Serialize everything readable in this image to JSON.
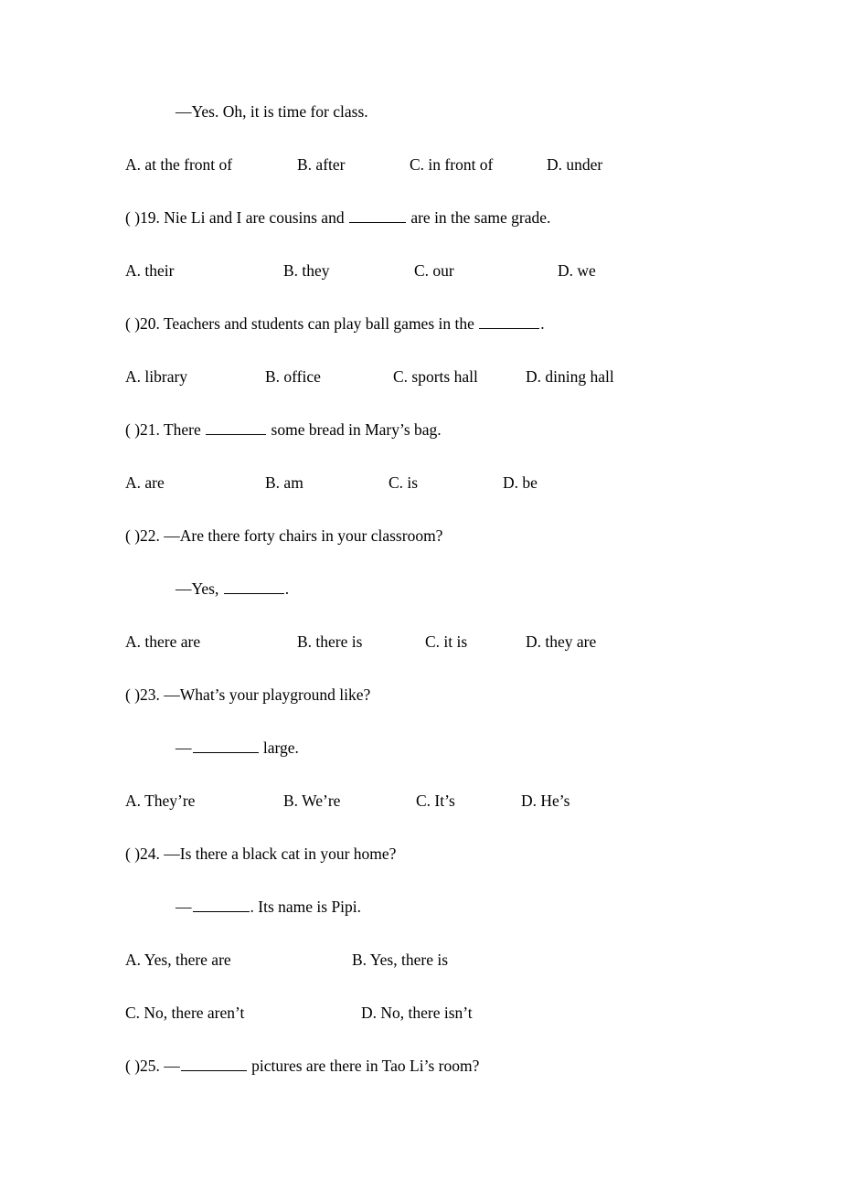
{
  "document": {
    "type": "english-exam-worksheet",
    "background_color": "#ffffff",
    "text_color": "#000000"
  },
  "blocks": [
    {
      "id": "q18-answer-line",
      "kind": "dialogue",
      "indent": true,
      "text": "—Yes. Oh, it is time for class."
    },
    {
      "id": "q18-options",
      "kind": "options",
      "columns": [
        137,
        325,
        448,
        598
      ],
      "options": [
        "A. at the front of",
        "B. after",
        "C. in front of",
        "D. under"
      ]
    },
    {
      "id": "q19-stem",
      "kind": "stem",
      "marker": "(  )19.",
      "before": " Nie Li and I are cousins and ",
      "blank": "w62",
      "after": " are in the same grade."
    },
    {
      "id": "q19-options",
      "kind": "options",
      "columns": [
        137,
        310,
        453,
        610
      ],
      "options": [
        "A. their",
        "B. they",
        "C. our",
        "D. we"
      ]
    },
    {
      "id": "q20-stem",
      "kind": "stem",
      "marker": "(  )20.",
      "before": " Teachers and students can play ball games in the ",
      "blank": "w66",
      "after": "."
    },
    {
      "id": "q20-options",
      "kind": "options",
      "columns": [
        137,
        290,
        430,
        575
      ],
      "options": [
        "A. library",
        "B. office",
        "C. sports hall",
        "D. dining hall"
      ]
    },
    {
      "id": "q21-stem",
      "kind": "stem",
      "marker": "(  )21.",
      "before": " There ",
      "blank": "w66",
      "after": " some bread in Mary’s bag."
    },
    {
      "id": "q21-options",
      "kind": "options",
      "columns": [
        137,
        290,
        425,
        550
      ],
      "options": [
        "A. are",
        "B. am",
        "C. is",
        "D. be"
      ]
    },
    {
      "id": "q22-stem",
      "kind": "plain-stem",
      "text": "(  )22. —Are there forty chairs in your classroom?"
    },
    {
      "id": "q22-answer-line",
      "kind": "dialogue-blank",
      "indent": true,
      "before": "—Yes, ",
      "blank": "w66",
      "after": "."
    },
    {
      "id": "q22-options",
      "kind": "options",
      "columns": [
        137,
        325,
        465,
        575
      ],
      "options": [
        "A. there are",
        "B. there is",
        "C. it is",
        "D. they are"
      ]
    },
    {
      "id": "q23-stem",
      "kind": "plain-stem",
      "text": "(  )23. —What’s your playground like?"
    },
    {
      "id": "q23-answer-line",
      "kind": "dialogue-blank",
      "indent": true,
      "before": "—",
      "blank": "w72",
      "after": " large."
    },
    {
      "id": "q23-options",
      "kind": "options",
      "columns": [
        137,
        310,
        455,
        570
      ],
      "options": [
        "A. They’re",
        "B. We’re",
        "C. It’s",
        "D. He’s"
      ]
    },
    {
      "id": "q24-stem",
      "kind": "plain-stem",
      "text": "(  )24. —Is there a black cat in your home?"
    },
    {
      "id": "q24-answer-line",
      "kind": "dialogue-blank",
      "indent": true,
      "before": "—",
      "blank": "w62",
      "after": ". Its name is Pipi."
    },
    {
      "id": "q24-options-row1",
      "kind": "options",
      "columns": [
        137,
        385
      ],
      "options": [
        "A. Yes, there are",
        "B. Yes, there is"
      ]
    },
    {
      "id": "q24-options-row2",
      "kind": "options",
      "columns": [
        137,
        395
      ],
      "options": [
        "C. No, there aren’t",
        "D. No, there isn’t"
      ]
    },
    {
      "id": "q25-stem",
      "kind": "stem",
      "marker": "(  )25.",
      "before": " —",
      "blank": "w72",
      "after": " pictures are there in Tao Li’s room?"
    }
  ]
}
